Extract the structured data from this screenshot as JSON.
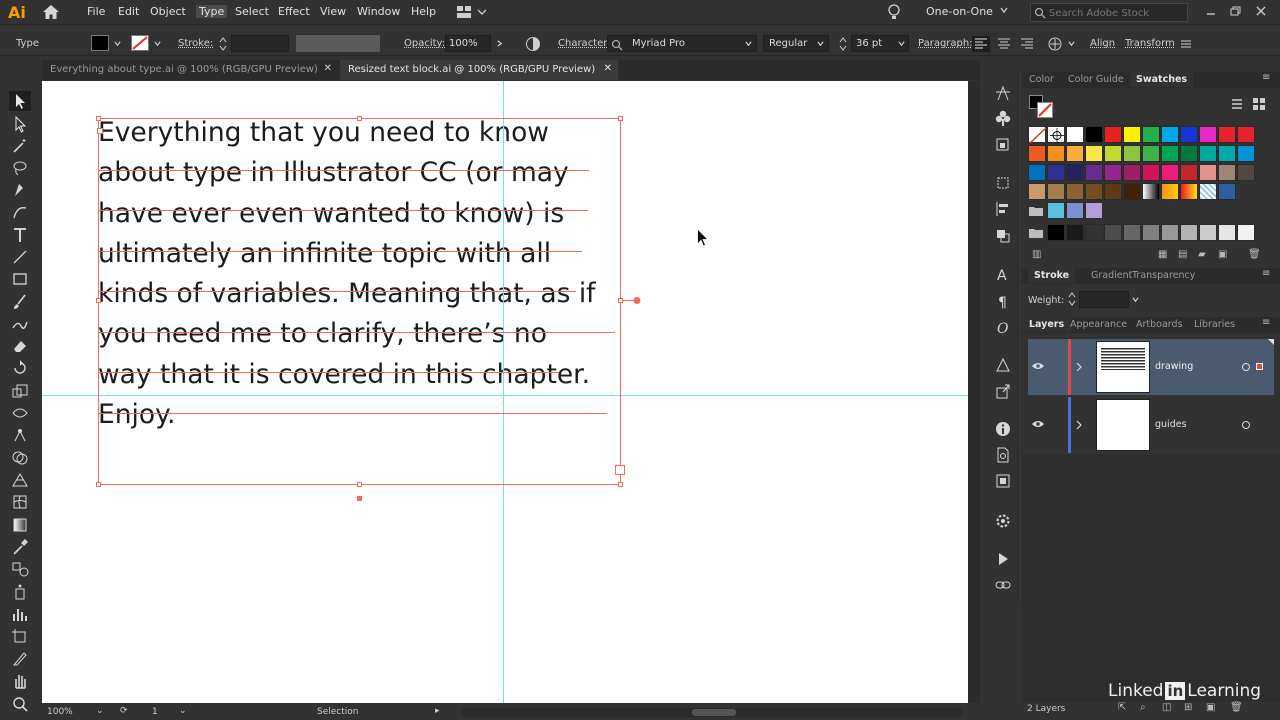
{
  "app": {
    "logo": "Ai"
  },
  "menu": [
    "File",
    "Edit",
    "Object",
    "Type",
    "Select",
    "Effect",
    "View",
    "Window",
    "Help"
  ],
  "workspace": "One-on-One",
  "search": {
    "placeholder": "Search Adobe Stock"
  },
  "control": {
    "tool_label": "Type",
    "stroke_label": "Stroke:",
    "opacity_label": "Opacity:",
    "opacity_value": "100%",
    "character_label": "Character:",
    "font": "Myriad Pro",
    "style": "Regular",
    "size": "36 pt",
    "paragraph_label": "Paragraph:",
    "align": "Align",
    "transform": "Transform"
  },
  "tabs": [
    {
      "label": "Everything about type.ai @ 100% (RGB/GPU Preview)"
    },
    {
      "label": "Resized text block.ai @ 100% (RGB/GPU Preview)"
    }
  ],
  "canvas": {
    "lines": [
      "Everything that you need to know",
      "about type in Illustrator CC (or may",
      "have ever even wanted to know) is",
      "ultimately an infinite topic with all",
      "kinds of variables. Meaning that, as if",
      "you need me to clarify, there’s no",
      "way that it is covered in this chapter.",
      "Enjoy."
    ]
  },
  "status": {
    "zoom": "100%",
    "artboard": "1",
    "tool": "Selection"
  },
  "panels": {
    "color_tabs": [
      "Color",
      "Color Guide",
      "Swatches"
    ],
    "stroke_tabs": [
      "Stroke",
      "Gradient",
      "Transparency"
    ],
    "weight_label": "Weight:",
    "layer_tabs": [
      "Layers",
      "Appearance",
      "Artboards",
      "Libraries"
    ],
    "layers": [
      {
        "name": "drawing",
        "color": "#e24a4a"
      },
      {
        "name": "guides",
        "color": "#4a6fe2"
      }
    ],
    "layer_count": "2 Layers"
  },
  "colors": {
    "selection": "#f26b5b",
    "guide": "#6ee0f0",
    "accent": "#ff9a00"
  },
  "watermark": {
    "pre": "Linked",
    "mid": "in",
    "post": "Learning"
  }
}
